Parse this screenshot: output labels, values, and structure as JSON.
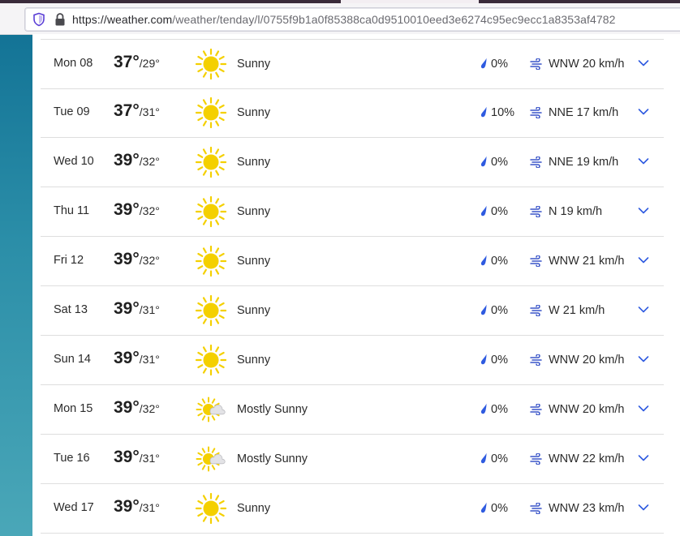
{
  "browser": {
    "url_host": "https://weather.com",
    "url_path": "/weather/tenday/l/0755f9b1a0f85388ca0d9510010eed3e6274c95ec9ecc1a8353af4782"
  },
  "colors": {
    "precip_blue": "#2f5be0",
    "wind_blue": "#3a55c8",
    "sun_yellow": "#f4d000",
    "chevron_blue": "#2f5be0"
  },
  "forecast": [
    {
      "day": "Mon 08",
      "high": "37°",
      "low": "29°",
      "condition": "Sunny",
      "icon": "sun-icon",
      "precip": "0%",
      "wind": "WNW 20 km/h"
    },
    {
      "day": "Tue 09",
      "high": "37°",
      "low": "31°",
      "condition": "Sunny",
      "icon": "sun-icon",
      "precip": "10%",
      "wind": "NNE 17 km/h"
    },
    {
      "day": "Wed 10",
      "high": "39°",
      "low": "32°",
      "condition": "Sunny",
      "icon": "sun-icon",
      "precip": "0%",
      "wind": "NNE 19 km/h"
    },
    {
      "day": "Thu 11",
      "high": "39°",
      "low": "32°",
      "condition": "Sunny",
      "icon": "sun-icon",
      "precip": "0%",
      "wind": "N 19 km/h"
    },
    {
      "day": "Fri 12",
      "high": "39°",
      "low": "32°",
      "condition": "Sunny",
      "icon": "sun-icon",
      "precip": "0%",
      "wind": "WNW 21 km/h"
    },
    {
      "day": "Sat 13",
      "high": "39°",
      "low": "31°",
      "condition": "Sunny",
      "icon": "sun-icon",
      "precip": "0%",
      "wind": "W 21 km/h"
    },
    {
      "day": "Sun 14",
      "high": "39°",
      "low": "31°",
      "condition": "Sunny",
      "icon": "sun-icon",
      "precip": "0%",
      "wind": "WNW 20 km/h"
    },
    {
      "day": "Mon 15",
      "high": "39°",
      "low": "32°",
      "condition": "Mostly Sunny",
      "icon": "mostly-sunny-icon",
      "precip": "0%",
      "wind": "WNW 20 km/h"
    },
    {
      "day": "Tue 16",
      "high": "39°",
      "low": "31°",
      "condition": "Mostly Sunny",
      "icon": "mostly-sunny-icon",
      "precip": "0%",
      "wind": "WNW 22 km/h"
    },
    {
      "day": "Wed 17",
      "high": "39°",
      "low": "31°",
      "condition": "Sunny",
      "icon": "sun-icon",
      "precip": "0%",
      "wind": "WNW 23 km/h"
    }
  ]
}
